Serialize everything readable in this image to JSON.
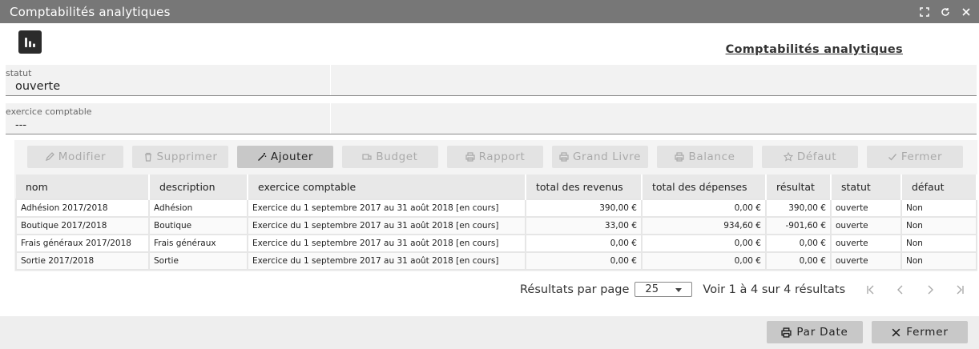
{
  "window": {
    "title": "Comptabilités analytiques"
  },
  "page": {
    "title": "Comptabilités analytiques"
  },
  "filters": {
    "statut": {
      "label": "statut",
      "value": "ouverte"
    },
    "exercice": {
      "label": "exercice comptable",
      "value": "---"
    }
  },
  "toolbar": {
    "modifier": "Modifier",
    "supprimer": "Supprimer",
    "ajouter": "Ajouter",
    "budget": "Budget",
    "rapport": "Rapport",
    "grand_livre": "Grand Livre",
    "balance": "Balance",
    "defaut": "Défaut",
    "fermer": "Fermer"
  },
  "table": {
    "headers": [
      "nom",
      "description",
      "exercice comptable",
      "total des revenus",
      "total des dépenses",
      "résultat",
      "statut",
      "défaut"
    ],
    "rows": [
      [
        "Adhésion 2017/2018",
        "Adhésion",
        "Exercice du 1 septembre 2017 au 31 août 2018 [en cours]",
        "390,00 €",
        "0,00 €",
        "390,00 €",
        "ouverte",
        "Non"
      ],
      [
        "Boutique 2017/2018",
        "Boutique",
        "Exercice du 1 septembre 2017 au 31 août 2018 [en cours]",
        "33,00 €",
        "934,60 €",
        "-901,60 €",
        "ouverte",
        "Non"
      ],
      [
        "Frais généraux 2017/2018",
        "Frais généraux",
        "Exercice du 1 septembre 2017 au 31 août 2018 [en cours]",
        "0,00 €",
        "0,00 €",
        "0,00 €",
        "ouverte",
        "Non"
      ],
      [
        "Sortie 2017/2018",
        "Sortie",
        "Exercice du 1 septembre 2017 au 31 août 2018 [en cours]",
        "0,00 €",
        "0,00 €",
        "0,00 €",
        "ouverte",
        "Non"
      ]
    ]
  },
  "pagination": {
    "per_page_label": "Résultats par page",
    "per_page_value": "25",
    "range_text": "Voir 1 à 4 sur 4 résultats"
  },
  "footer": {
    "par_date": "Par Date",
    "fermer": "Fermer"
  },
  "colors": {
    "titlebar": "#777777",
    "active_button": "#c8c8c8",
    "disabled_button": "#e3e3e3"
  }
}
